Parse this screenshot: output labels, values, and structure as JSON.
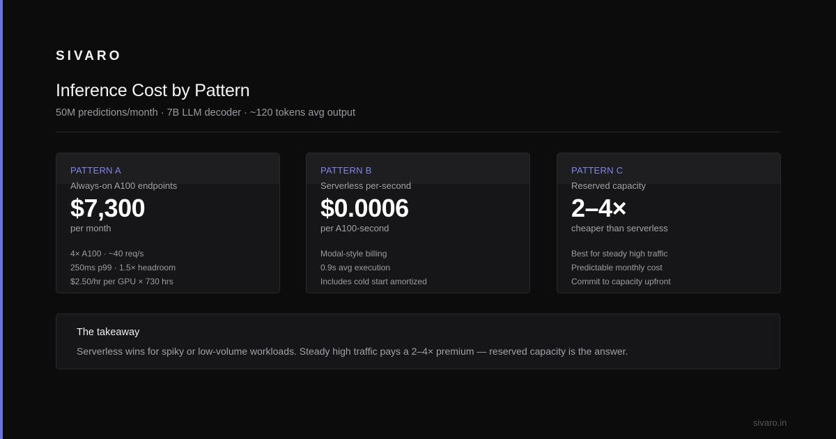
{
  "brand": "SIVARO",
  "title": "Inference Cost by Pattern",
  "subtitle": "50M predictions/month · 7B LLM decoder · ~120 tokens avg output",
  "colors": {
    "background": "#0c0c0c",
    "accent": "#6b73e0",
    "card_label": "#7f86e8",
    "card_background": "#161618"
  },
  "cards": [
    {
      "label": "PATTERN A",
      "subtitle": "Always-on A100 endpoints",
      "value": "$7,300",
      "unit": "per month",
      "notes": [
        "4× A100 · ~40 req/s",
        "250ms p99 · 1.5× headroom",
        "$2.50/hr per GPU × 730 hrs"
      ]
    },
    {
      "label": "PATTERN B",
      "subtitle": "Serverless per-second",
      "value": "$0.0006",
      "unit": "per A100-second",
      "notes": [
        "Modal-style billing",
        "0.9s avg execution",
        "Includes cold start amortized"
      ]
    },
    {
      "label": "PATTERN C",
      "subtitle": "Reserved capacity",
      "value": "2–4×",
      "unit": "cheaper than serverless",
      "notes": [
        "Best for steady high traffic",
        "Predictable monthly cost",
        "Commit to capacity upfront"
      ]
    }
  ],
  "takeaway": {
    "title": "The takeaway",
    "body": "Serverless wins for spiky or low-volume workloads. Steady high traffic pays a 2–4× premium — reserved capacity is the answer."
  },
  "footer": {
    "url": "sivaro.in"
  }
}
